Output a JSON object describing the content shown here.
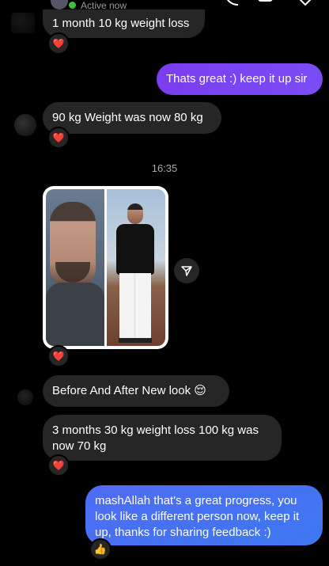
{
  "header": {
    "status": "Active now",
    "status_color": "#3ec13e",
    "icons": [
      "phone-icon",
      "video-icon",
      "heart-icon"
    ]
  },
  "messages": {
    "m1": "1 month 10 kg weight loss",
    "m2": "Thats great :) keep it up sir",
    "m3": "90 kg Weight was now 80 kg",
    "timestamp": "16:35",
    "m4": "Before And After New look 😌",
    "m5": "3 months 30 kg weight loss 100 kg was now 70 kg",
    "m6": "mashAllah that's a great progress, you look like a different person now, keep it up, thanks for sharing feedback :)"
  },
  "reactions": {
    "heart": "❤️",
    "thumbs": "👍"
  },
  "colors": {
    "received_bubble": "#262626",
    "sent_purple": "#7a3df0",
    "sent_blue": "#4f6bf5"
  }
}
